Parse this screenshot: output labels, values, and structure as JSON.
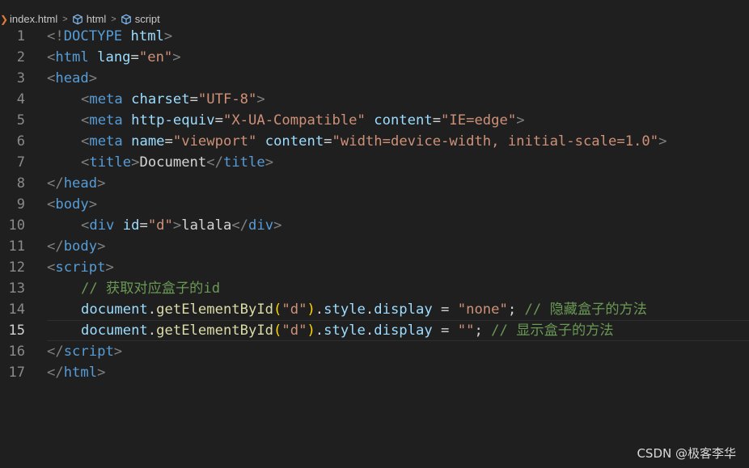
{
  "breadcrumb": {
    "items": [
      {
        "label": "index.html"
      },
      {
        "label": "html",
        "icon": "element-cube-icon"
      },
      {
        "label": "script",
        "icon": "element-cube-icon"
      }
    ]
  },
  "editor": {
    "current_line": 15,
    "lines": [
      {
        "n": "1",
        "tokens": [
          {
            "t": "<!",
            "c": "punct"
          },
          {
            "t": "DOCTYPE",
            "c": "tag"
          },
          {
            "t": " ",
            "c": "text"
          },
          {
            "t": "html",
            "c": "attr"
          },
          {
            "t": ">",
            "c": "punct"
          }
        ]
      },
      {
        "n": "2",
        "tokens": [
          {
            "t": "<",
            "c": "punct"
          },
          {
            "t": "html",
            "c": "tag"
          },
          {
            "t": " ",
            "c": "text"
          },
          {
            "t": "lang",
            "c": "attr"
          },
          {
            "t": "=",
            "c": "text"
          },
          {
            "t": "\"en\"",
            "c": "str"
          },
          {
            "t": ">",
            "c": "punct"
          }
        ]
      },
      {
        "n": "3",
        "tokens": [
          {
            "t": "<",
            "c": "punct"
          },
          {
            "t": "head",
            "c": "tag"
          },
          {
            "t": ">",
            "c": "punct"
          }
        ]
      },
      {
        "n": "4",
        "indent": 1,
        "tokens": [
          {
            "t": "<",
            "c": "punct"
          },
          {
            "t": "meta",
            "c": "tag"
          },
          {
            "t": " ",
            "c": "text"
          },
          {
            "t": "charset",
            "c": "attr"
          },
          {
            "t": "=",
            "c": "text"
          },
          {
            "t": "\"UTF-8\"",
            "c": "str"
          },
          {
            "t": ">",
            "c": "punct"
          }
        ]
      },
      {
        "n": "5",
        "indent": 1,
        "tokens": [
          {
            "t": "<",
            "c": "punct"
          },
          {
            "t": "meta",
            "c": "tag"
          },
          {
            "t": " ",
            "c": "text"
          },
          {
            "t": "http-equiv",
            "c": "attr"
          },
          {
            "t": "=",
            "c": "text"
          },
          {
            "t": "\"X-UA-Compatible\"",
            "c": "str"
          },
          {
            "t": " ",
            "c": "text"
          },
          {
            "t": "content",
            "c": "attr"
          },
          {
            "t": "=",
            "c": "text"
          },
          {
            "t": "\"IE=edge\"",
            "c": "str"
          },
          {
            "t": ">",
            "c": "punct"
          }
        ]
      },
      {
        "n": "6",
        "indent": 1,
        "tokens": [
          {
            "t": "<",
            "c": "punct"
          },
          {
            "t": "meta",
            "c": "tag"
          },
          {
            "t": " ",
            "c": "text"
          },
          {
            "t": "name",
            "c": "attr"
          },
          {
            "t": "=",
            "c": "text"
          },
          {
            "t": "\"viewport\"",
            "c": "str"
          },
          {
            "t": " ",
            "c": "text"
          },
          {
            "t": "content",
            "c": "attr"
          },
          {
            "t": "=",
            "c": "text"
          },
          {
            "t": "\"width=device-width, initial-scale=1.0\"",
            "c": "str"
          },
          {
            "t": ">",
            "c": "punct"
          }
        ]
      },
      {
        "n": "7",
        "indent": 1,
        "tokens": [
          {
            "t": "<",
            "c": "punct"
          },
          {
            "t": "title",
            "c": "tag"
          },
          {
            "t": ">",
            "c": "punct"
          },
          {
            "t": "Document",
            "c": "text"
          },
          {
            "t": "</",
            "c": "punct"
          },
          {
            "t": "title",
            "c": "tag"
          },
          {
            "t": ">",
            "c": "punct"
          }
        ]
      },
      {
        "n": "8",
        "tokens": [
          {
            "t": "</",
            "c": "punct"
          },
          {
            "t": "head",
            "c": "tag"
          },
          {
            "t": ">",
            "c": "punct"
          }
        ]
      },
      {
        "n": "9",
        "tokens": [
          {
            "t": "<",
            "c": "punct"
          },
          {
            "t": "body",
            "c": "tag"
          },
          {
            "t": ">",
            "c": "punct"
          }
        ]
      },
      {
        "n": "10",
        "indent": 1,
        "tokens": [
          {
            "t": "<",
            "c": "punct"
          },
          {
            "t": "div",
            "c": "tag"
          },
          {
            "t": " ",
            "c": "text"
          },
          {
            "t": "id",
            "c": "attr"
          },
          {
            "t": "=",
            "c": "text"
          },
          {
            "t": "\"d\"",
            "c": "str"
          },
          {
            "t": ">",
            "c": "punct"
          },
          {
            "t": "lalala",
            "c": "text"
          },
          {
            "t": "</",
            "c": "punct"
          },
          {
            "t": "div",
            "c": "tag"
          },
          {
            "t": ">",
            "c": "punct"
          }
        ]
      },
      {
        "n": "11",
        "tokens": [
          {
            "t": "</",
            "c": "punct"
          },
          {
            "t": "body",
            "c": "tag"
          },
          {
            "t": ">",
            "c": "punct"
          }
        ]
      },
      {
        "n": "12",
        "tokens": [
          {
            "t": "<",
            "c": "punct"
          },
          {
            "t": "script",
            "c": "tag"
          },
          {
            "t": ">",
            "c": "punct"
          }
        ]
      },
      {
        "n": "13",
        "indent": 1,
        "tokens": [
          {
            "t": "// ",
            "c": "comment"
          },
          {
            "t": "获取对应盒子的",
            "c": "comment cjk"
          },
          {
            "t": "id",
            "c": "comment"
          }
        ]
      },
      {
        "n": "14",
        "indent": 1,
        "tokens": [
          {
            "t": "document",
            "c": "var"
          },
          {
            "t": ".",
            "c": "text"
          },
          {
            "t": "getElementById",
            "c": "fn"
          },
          {
            "t": "(",
            "c": "paren"
          },
          {
            "t": "\"d\"",
            "c": "str"
          },
          {
            "t": ")",
            "c": "paren"
          },
          {
            "t": ".",
            "c": "text"
          },
          {
            "t": "style",
            "c": "var"
          },
          {
            "t": ".",
            "c": "text"
          },
          {
            "t": "display",
            "c": "var"
          },
          {
            "t": " = ",
            "c": "text"
          },
          {
            "t": "\"none\"",
            "c": "str"
          },
          {
            "t": "; ",
            "c": "text"
          },
          {
            "t": "// ",
            "c": "comment"
          },
          {
            "t": "隐藏盒子的方法",
            "c": "comment cjk"
          }
        ]
      },
      {
        "n": "15",
        "indent": 1,
        "tokens": [
          {
            "t": "document",
            "c": "var"
          },
          {
            "t": ".",
            "c": "text"
          },
          {
            "t": "getElementById",
            "c": "fn"
          },
          {
            "t": "(",
            "c": "paren"
          },
          {
            "t": "\"d\"",
            "c": "str"
          },
          {
            "t": ")",
            "c": "paren"
          },
          {
            "t": ".",
            "c": "text"
          },
          {
            "t": "style",
            "c": "var"
          },
          {
            "t": ".",
            "c": "text"
          },
          {
            "t": "display",
            "c": "var"
          },
          {
            "t": " = ",
            "c": "text"
          },
          {
            "t": "\"\"",
            "c": "str"
          },
          {
            "t": "; ",
            "c": "text"
          },
          {
            "t": "// ",
            "c": "comment"
          },
          {
            "t": "显示盒子的方法",
            "c": "comment cjk"
          }
        ]
      },
      {
        "n": "16",
        "tokens": [
          {
            "t": "</",
            "c": "punct"
          },
          {
            "t": "script",
            "c": "tag"
          },
          {
            "t": ">",
            "c": "punct"
          }
        ]
      },
      {
        "n": "17",
        "tokens": [
          {
            "t": "</",
            "c": "punct"
          },
          {
            "t": "html",
            "c": "tag"
          },
          {
            "t": ">",
            "c": "punct"
          }
        ]
      }
    ]
  },
  "watermark": {
    "text": "CSDN @极客李华"
  },
  "colors": {
    "background": "#1f1f1f",
    "tag": "#569cd6",
    "attr": "#9cdcfe",
    "string": "#ce9178",
    "comment": "#6a9955",
    "function": "#dcdcaa",
    "paren": "#ffd700"
  }
}
